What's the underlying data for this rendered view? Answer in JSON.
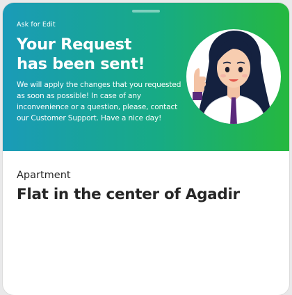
{
  "banner": {
    "eyebrow": "Ask for Edit",
    "headline_line1": "Your Request",
    "headline_line2": "has been sent!",
    "message": "We will apply the changes that you requested as soon as possible! In case of any inconvenience or a question, please, contact our Customer Support. Have a nice day!"
  },
  "listing": {
    "category": "Apartment",
    "title": "Flat in the center of Agadir"
  },
  "colors": {
    "gradient_start": "#1a9bb8",
    "gradient_end": "#25b83f",
    "text_dark": "#262626"
  },
  "icons": {
    "avatar": "support-agent-thumbs-up-avatar"
  }
}
